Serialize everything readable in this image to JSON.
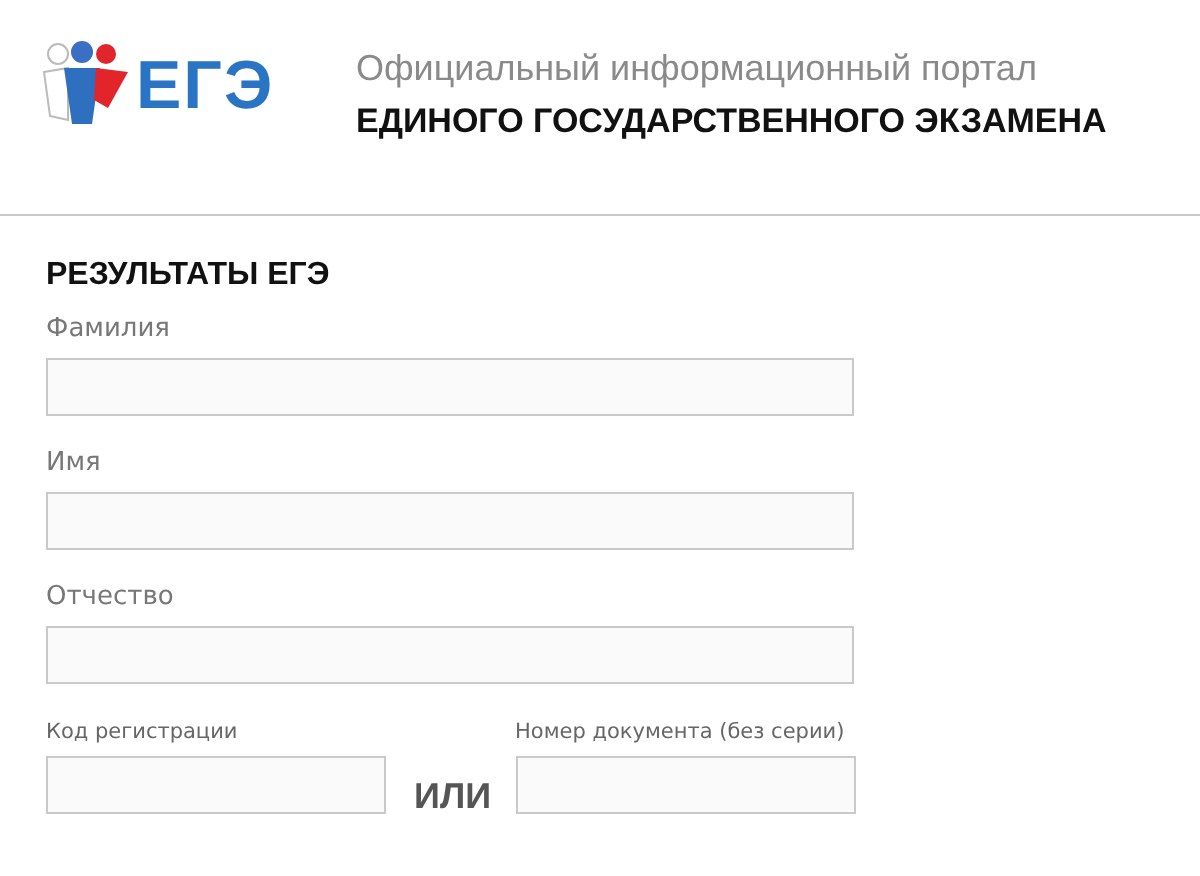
{
  "header": {
    "logo_text": "ЕГЭ",
    "subtitle": "Официальный информационный портал",
    "title": "ЕДИНОГО ГОСУДАРСТВЕННОГО ЭКЗАМЕНА"
  },
  "form": {
    "heading": "РЕЗУЛЬТАТЫ ЕГЭ",
    "fields": [
      {
        "label": "Фамилия"
      },
      {
        "label": "Имя"
      },
      {
        "label": "Отчество"
      }
    ],
    "alt_fields": [
      {
        "label": "Код регистрации"
      },
      {
        "label": "Номер документа (без серии)"
      }
    ],
    "separator": "ИЛИ"
  }
}
